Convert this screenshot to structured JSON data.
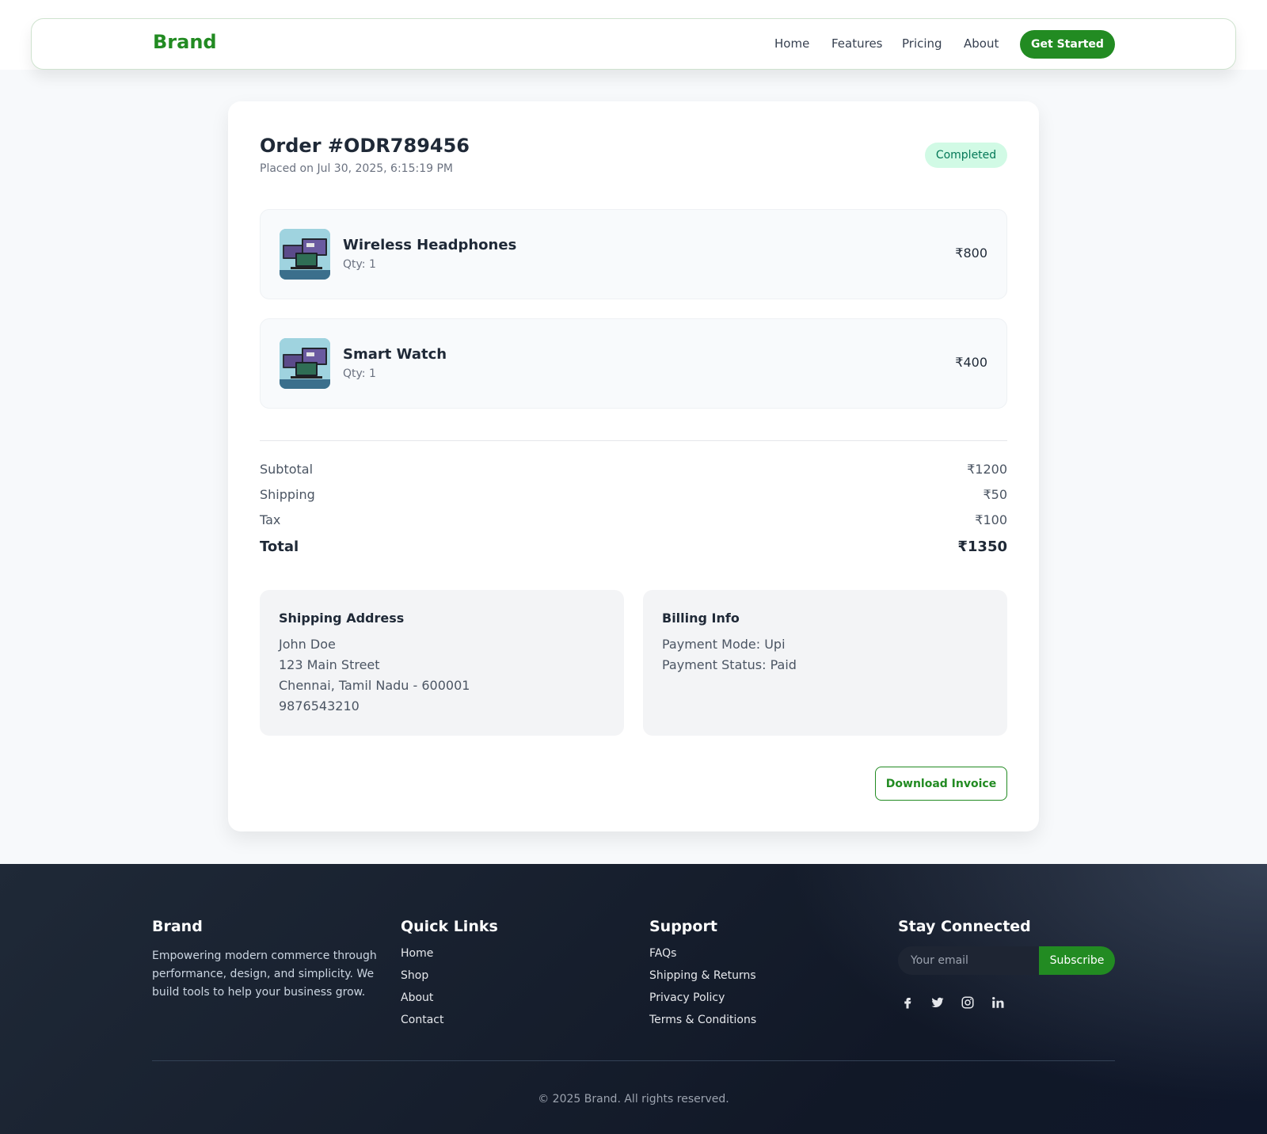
{
  "header": {
    "brand": "Brand",
    "nav": [
      "Home",
      "Features",
      "Pricing",
      "About"
    ],
    "cta": "Get Started"
  },
  "order": {
    "title": "Order #ODR789456",
    "placed": "Placed on Jul 30, 2025, 6:15:19 PM",
    "status": "Completed",
    "items": [
      {
        "name": "Wireless Headphones",
        "qty": "Qty: 1",
        "price": "₹800"
      },
      {
        "name": "Smart Watch",
        "qty": "Qty: 1",
        "price": "₹400"
      }
    ],
    "summary": {
      "subtotal_label": "Subtotal",
      "subtotal": "₹1200",
      "shipping_label": "Shipping",
      "shipping": "₹50",
      "tax_label": "Tax",
      "tax": "₹100",
      "total_label": "Total",
      "total": "₹1350"
    },
    "shipping_address": {
      "title": "Shipping Address",
      "lines": [
        "John Doe",
        "123 Main Street",
        "Chennai, Tamil Nadu - 600001",
        "9876543210"
      ]
    },
    "billing": {
      "title": "Billing Info",
      "lines": [
        "Payment Mode: Upi",
        "Payment Status: Paid"
      ]
    },
    "download_label": "Download Invoice"
  },
  "footer": {
    "brand": "Brand",
    "about": "Empowering modern commerce through performance, design, and simplicity. We build tools to help your business grow.",
    "quick_links_title": "Quick Links",
    "quick_links": [
      "Home",
      "Shop",
      "About",
      "Contact"
    ],
    "support_title": "Support",
    "support_links": [
      "FAQs",
      "Shipping & Returns",
      "Privacy Policy",
      "Terms & Conditions"
    ],
    "connect_title": "Stay Connected",
    "email_placeholder": "Your email",
    "subscribe_label": "Subscribe",
    "socials": [
      "facebook-icon",
      "twitter-icon",
      "instagram-icon",
      "linkedin-icon"
    ],
    "copyright": "© 2025 Brand. All rights reserved."
  },
  "colors": {
    "accent": "#228b22",
    "status_bg": "#d1fae5",
    "status_text": "#047857",
    "footer_bg": "#1f2937"
  }
}
